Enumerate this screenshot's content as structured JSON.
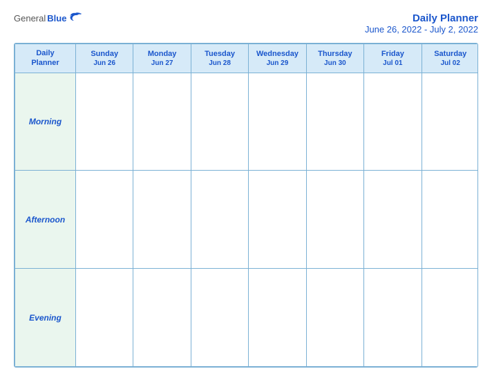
{
  "header": {
    "logo": {
      "general_text": "General",
      "blue_text": "Blue"
    },
    "title": "Daily Planner",
    "subtitle": "June 26, 2022 - July 2, 2022"
  },
  "columns": [
    {
      "label": "Daily\nPlanner",
      "date": ""
    },
    {
      "label": "Sunday",
      "date": "Jun 26"
    },
    {
      "label": "Monday",
      "date": "Jun 27"
    },
    {
      "label": "Tuesday",
      "date": "Jun 28"
    },
    {
      "label": "Wednesday",
      "date": "Jun 29"
    },
    {
      "label": "Thursday",
      "date": "Jun 30"
    },
    {
      "label": "Friday",
      "date": "Jul 01"
    },
    {
      "label": "Saturday",
      "date": "Jul 02"
    }
  ],
  "rows": [
    {
      "label": "Morning"
    },
    {
      "label": "Afternoon"
    },
    {
      "label": "Evening"
    }
  ]
}
